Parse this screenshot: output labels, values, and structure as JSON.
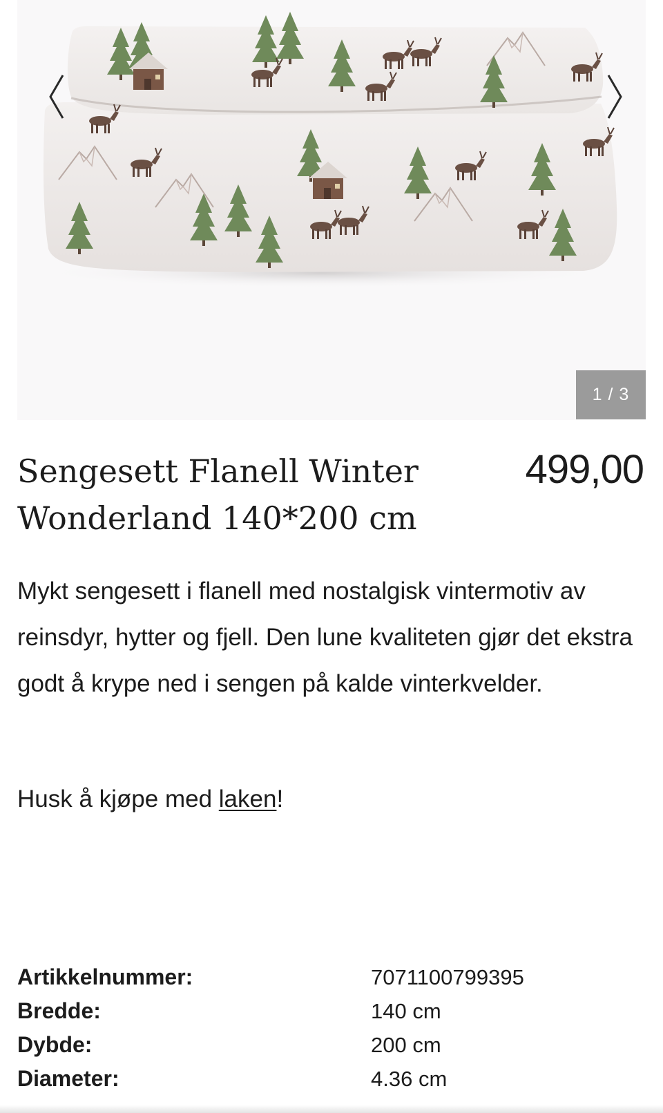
{
  "gallery": {
    "image_alt": "Sengesett Flanell Winter Wonderland",
    "counter": "1 / 3",
    "prev_icon": "chevron-left-icon",
    "next_icon": "chevron-right-icon"
  },
  "product": {
    "title": "Sengesett Flanell Winter Wonderland 140*200 cm",
    "price": "499,00",
    "description": "Mykt sengesett i flanell med nostalgisk vintermotiv av reinsdyr, hytter og fjell. Den lune kvaliteten gjør det ekstra godt å krype ned i sengen på kalde vinterkvelder.",
    "reminder_prefix": "Husk å kjøpe med ",
    "reminder_link": "laken",
    "reminder_suffix": "!"
  },
  "specs": [
    {
      "label": "Artikkelnummer:",
      "value": "7071100799395"
    },
    {
      "label": "Bredde:",
      "value": "140 cm"
    },
    {
      "label": "Dybde:",
      "value": "200 cm"
    },
    {
      "label": "Diameter:",
      "value": "4.36 cm"
    }
  ],
  "colors": {
    "text": "#1c1c1c",
    "counter_bg": "#9b9b9b",
    "image_bg": "#f9f8f9"
  }
}
